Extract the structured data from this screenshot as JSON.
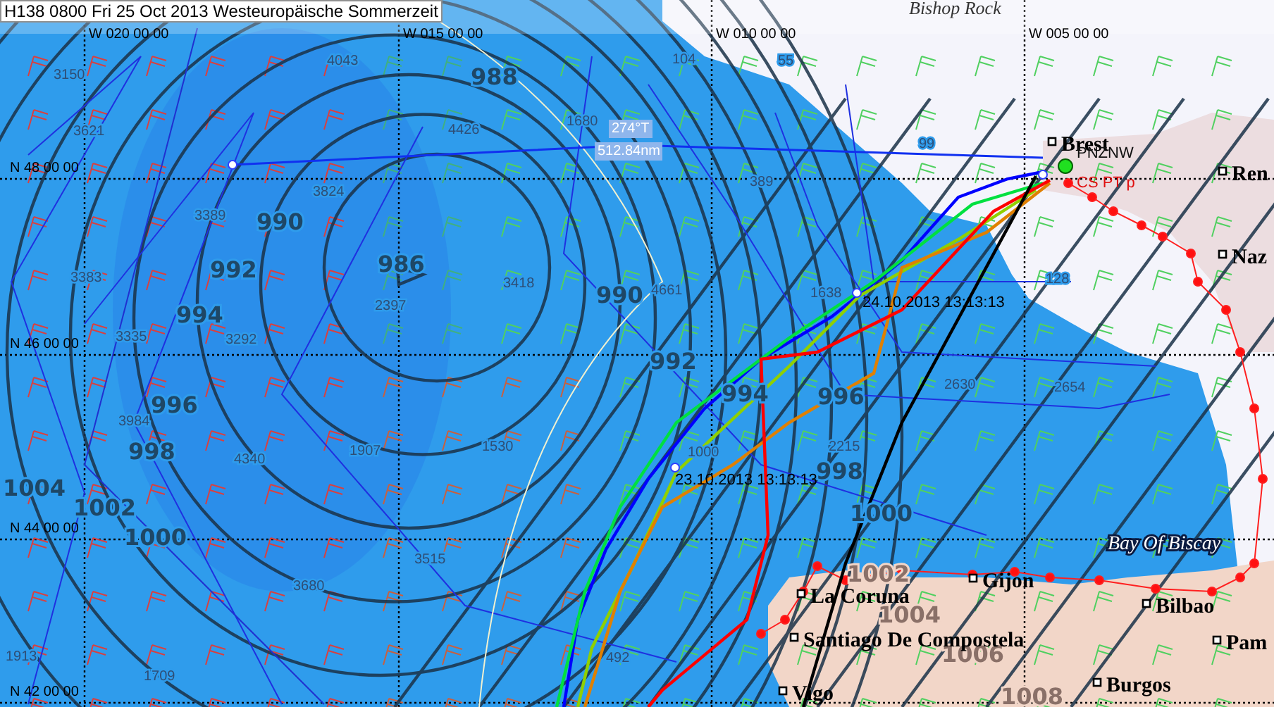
{
  "header": {
    "title": "H138 0800 Fri 25 Oct 2013 Westeuropäische Sommerzeit"
  },
  "grid_labels": [
    {
      "kind": "lon",
      "text": "W 020 00 00"
    },
    {
      "kind": "lon",
      "text": "W 015 00 00"
    },
    {
      "kind": "lon",
      "text": "W 010 00 00"
    },
    {
      "kind": "lon",
      "text": "W 005 00 00"
    },
    {
      "kind": "lat",
      "text": "N 48 00 00"
    },
    {
      "kind": "lat",
      "text": "N 46 00 00"
    },
    {
      "kind": "lat",
      "text": "N 44 00 00"
    },
    {
      "kind": "lat",
      "text": "N 42 00 00"
    }
  ],
  "place_labels": [
    "Bishop Rock"
  ],
  "isobar_labels": [
    "988",
    "986",
    "990",
    "992",
    "994",
    "996",
    "998",
    "1004",
    "1002",
    "1000",
    "990",
    "992",
    "994",
    "996",
    "998",
    "1000",
    "1002",
    "1004",
    "1006",
    "1008"
  ],
  "depth_labels": [
    "3150",
    "3621",
    "3389",
    "3824",
    "3383",
    "3335",
    "3292",
    "4043",
    "4426",
    "1680",
    "2397",
    "3418",
    "4661",
    "104",
    "55",
    "99",
    "389",
    "128",
    "1638",
    "3984",
    "4340",
    "1907",
    "1530",
    "3515",
    "3680",
    "1913",
    "1709",
    "492",
    "1000",
    "2215",
    "2630",
    "2654"
  ],
  "cities": [
    "Brest",
    "Ren",
    "Naz",
    "La Coruna",
    "Gijon",
    "Bilbao",
    "Santiago De Compostela",
    "Burgos",
    "Vigo",
    "Pam"
  ],
  "sea_label": "Bay Of Biscay",
  "bearing": {
    "course": "274°T",
    "distance": "512.84nm"
  },
  "boat_labels": [
    "PNZNW",
    "CS PT p"
  ],
  "timestamps": [
    "24.10.2013 13:13:13",
    "23.10.2013 13:13:13"
  ],
  "routes": [
    {
      "color": "#0000ff"
    },
    {
      "color": "#00e040"
    },
    {
      "color": "#90d000"
    },
    {
      "color": "#e08000"
    },
    {
      "color": "#ff0000"
    },
    {
      "color": "#000000"
    }
  ]
}
